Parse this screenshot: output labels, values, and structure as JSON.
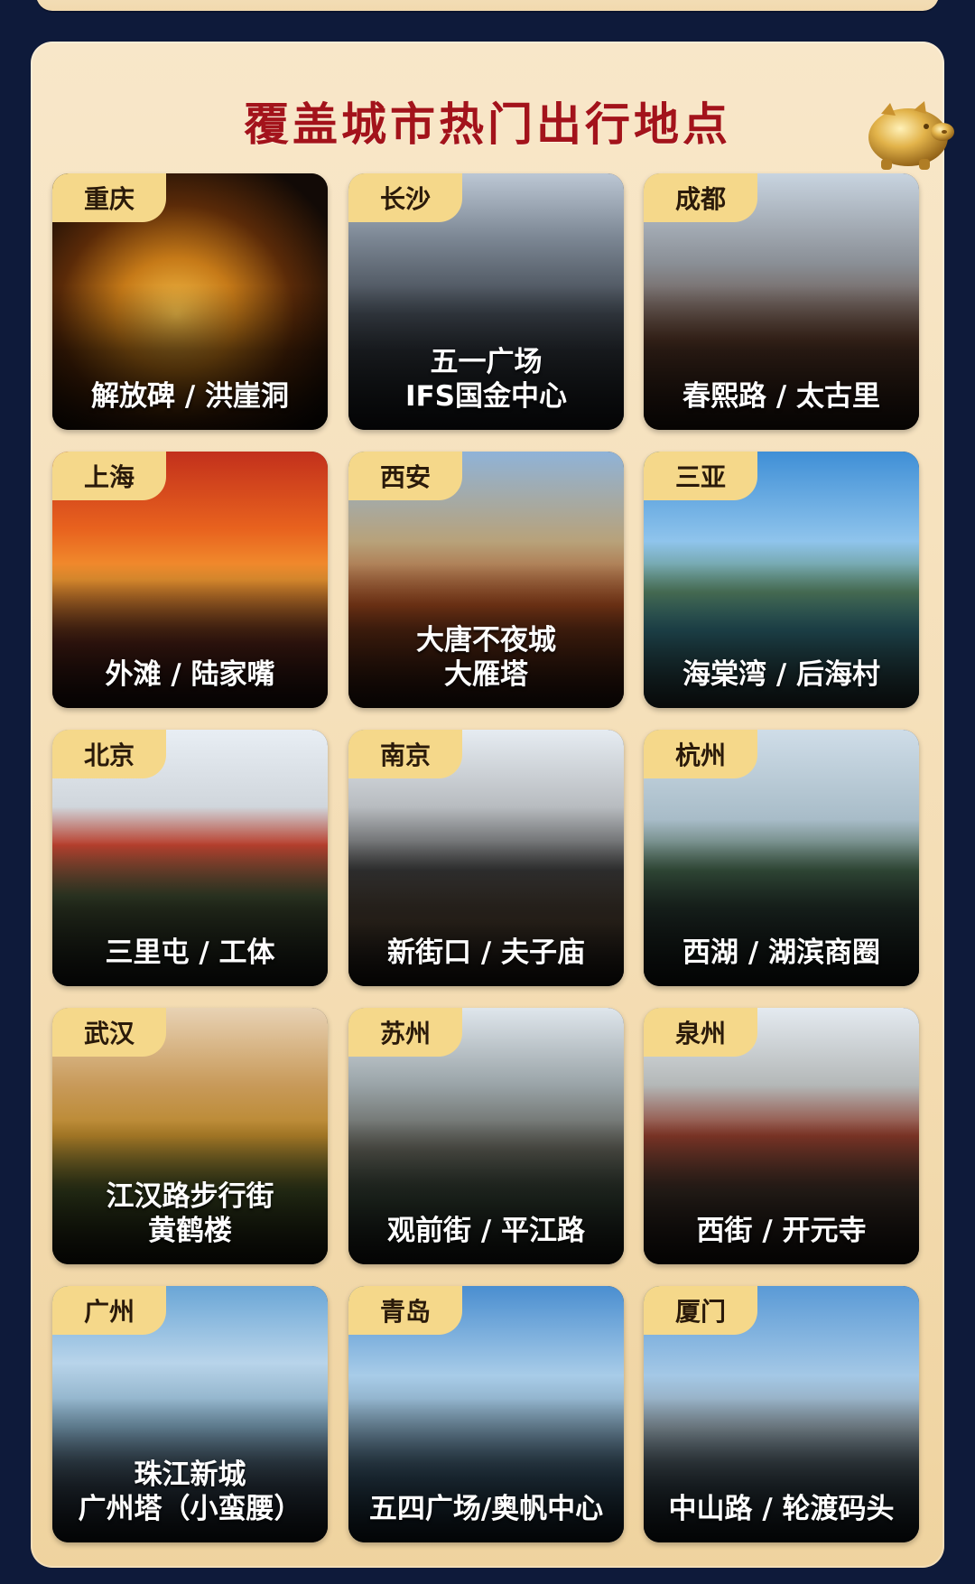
{
  "header": {
    "title": "覆盖城市热门出行地点"
  },
  "cards": [
    {
      "city": "重庆",
      "lines": [
        "解放碑 / 洪崖洞"
      ]
    },
    {
      "city": "长沙",
      "lines": [
        "五一广场",
        "IFS国金中心"
      ]
    },
    {
      "city": "成都",
      "lines": [
        "春熙路 / 太古里"
      ]
    },
    {
      "city": "上海",
      "lines": [
        "外滩 / 陆家嘴"
      ]
    },
    {
      "city": "西安",
      "lines": [
        "大唐不夜城",
        "大雁塔"
      ]
    },
    {
      "city": "三亚",
      "lines": [
        "海棠湾 / 后海村"
      ]
    },
    {
      "city": "北京",
      "lines": [
        "三里屯 / 工体"
      ]
    },
    {
      "city": "南京",
      "lines": [
        "新街口 / 夫子庙"
      ]
    },
    {
      "city": "杭州",
      "lines": [
        "西湖 / 湖滨商圈"
      ]
    },
    {
      "city": "武汉",
      "lines": [
        "江汉路步行街",
        "黄鹤楼"
      ]
    },
    {
      "city": "苏州",
      "lines": [
        "观前街 / 平江路"
      ]
    },
    {
      "city": "泉州",
      "lines": [
        "西街 / 开元寺"
      ]
    },
    {
      "city": "广州",
      "lines": [
        "珠江新城",
        "广州塔（小蛮腰）"
      ]
    },
    {
      "city": "青岛",
      "lines": [
        "五四广场/奥帆中心"
      ]
    },
    {
      "city": "厦门",
      "lines": [
        "中山路 / 轮渡码头"
      ]
    }
  ],
  "colors": {
    "title": "#a3131b",
    "tag_bg": "#f5d88a",
    "panel": "#f6e2bd",
    "page_bg": "#0e1a3a"
  },
  "icons": {
    "mascot": "golden-pig-icon"
  }
}
